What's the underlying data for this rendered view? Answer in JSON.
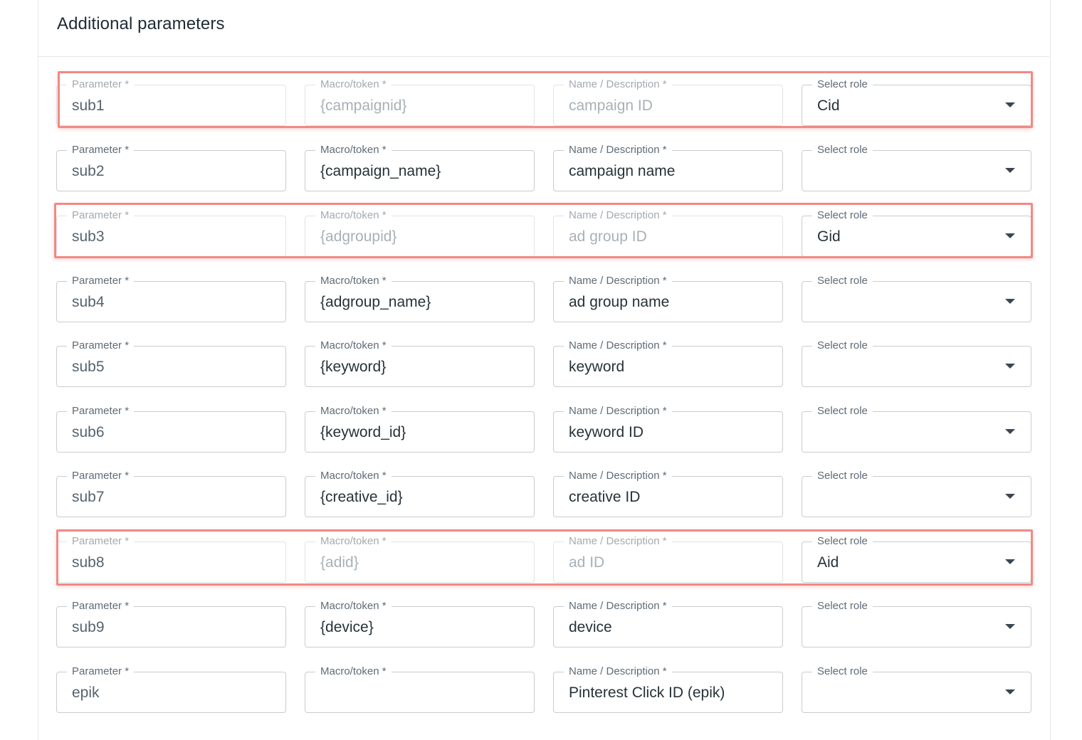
{
  "card": {
    "title": "Additional parameters"
  },
  "labels": {
    "parameter": "Parameter *",
    "macro": "Macro/token *",
    "name": "Name / Description *",
    "role": "Select role"
  },
  "rows": [
    {
      "parameter": "sub1",
      "macro": "{campaignid}",
      "name": "campaign ID",
      "role": "Cid",
      "highlighted": true,
      "disabled": true
    },
    {
      "parameter": "sub2",
      "macro": "{campaign_name}",
      "name": "campaign name",
      "role": "",
      "highlighted": false,
      "disabled": false
    },
    {
      "parameter": "sub3",
      "macro": "{adgroupid}",
      "name": "ad group ID",
      "role": "Gid",
      "highlighted": true,
      "disabled": true
    },
    {
      "parameter": "sub4",
      "macro": "{adgroup_name}",
      "name": "ad group name",
      "role": "",
      "highlighted": false,
      "disabled": false
    },
    {
      "parameter": "sub5",
      "macro": "{keyword}",
      "name": "keyword",
      "role": "",
      "highlighted": false,
      "disabled": false
    },
    {
      "parameter": "sub6",
      "macro": "{keyword_id}",
      "name": "keyword ID",
      "role": "",
      "highlighted": false,
      "disabled": false
    },
    {
      "parameter": "sub7",
      "macro": "{creative_id}",
      "name": "creative ID",
      "role": "",
      "highlighted": false,
      "disabled": false
    },
    {
      "parameter": "sub8",
      "macro": "{adid}",
      "name": "ad ID",
      "role": "Aid",
      "highlighted": true,
      "disabled": true
    },
    {
      "parameter": "sub9",
      "macro": "{device}",
      "name": "device",
      "role": "",
      "highlighted": false,
      "disabled": false
    },
    {
      "parameter": "epik",
      "macro": "",
      "name": "Pinterest Click ID (epik)",
      "role": "",
      "highlighted": false,
      "disabled": false
    }
  ],
  "colors": {
    "highlight": "#f08a84",
    "border": "#c8ccd0",
    "text": "#263238"
  }
}
